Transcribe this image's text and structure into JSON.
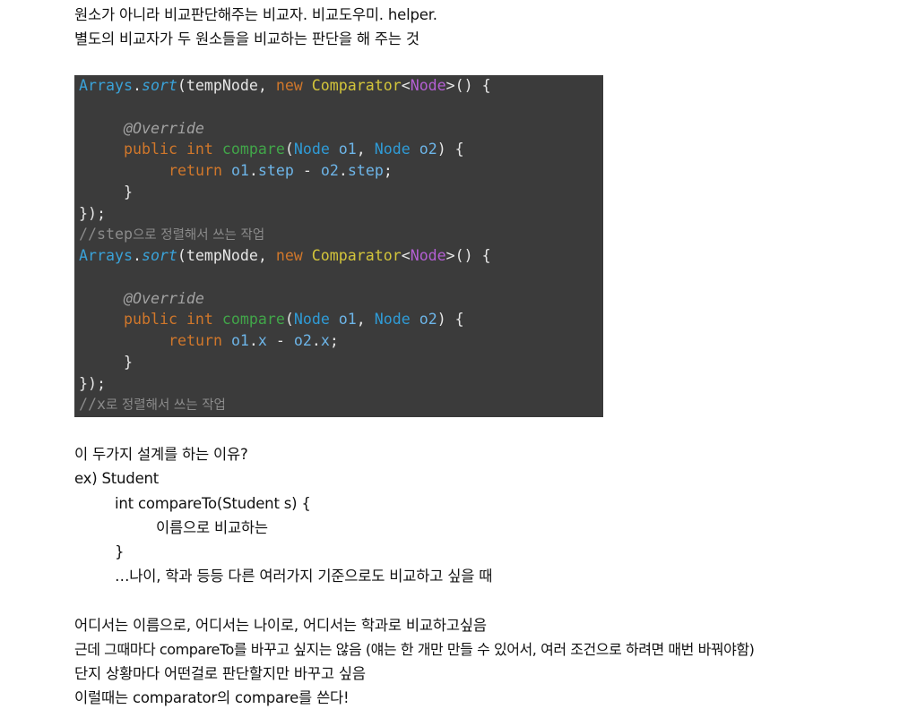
{
  "intro": {
    "line1": "원소가 아니라 비교판단해주는 비교자. 비교도우미. helper.",
    "line2": "별도의 비교자가 두 원소들을 비교하는 판단을 해 주는 것"
  },
  "code": {
    "block1": {
      "l1": {
        "cls": "Arrays",
        "dot": ".",
        "method": "sort",
        "open": "(tempNode, ",
        "kw_new": "new ",
        "comparator": "Comparator",
        "lt": "<",
        "generic": "Node",
        "gt_paren": ">() {"
      },
      "l2": {
        "annotation": "@Override"
      },
      "l3": {
        "kw_public": "public ",
        "kw_int": "int ",
        "method": "compare",
        "paren_open": "(",
        "type1": "Node ",
        "param1": "o1",
        "comma": ", ",
        "type2": "Node ",
        "param2": "o2",
        "paren_close": ") {"
      },
      "l4": {
        "kw_return": "return ",
        "a": "o1",
        "dot1": ".",
        "field_a": "step",
        "minus": " - ",
        "b": "o2",
        "dot2": ".",
        "field_b": "step",
        "semi": ";"
      },
      "l5": "}",
      "l6": "});",
      "comment_prefix": "//step",
      "comment_ko": "으로 정렬해서 쓰는 작업"
    },
    "block2": {
      "l1": {
        "cls": "Arrays",
        "dot": ".",
        "method": "sort",
        "open": "(tempNode, ",
        "kw_new": "new ",
        "comparator": "Comparator",
        "lt": "<",
        "generic": "Node",
        "gt_paren": ">() {"
      },
      "l2": {
        "annotation": "@Override"
      },
      "l3": {
        "kw_public": "public ",
        "kw_int": "int ",
        "method": "compare",
        "paren_open": "(",
        "type1": "Node ",
        "param1": "o1",
        "comma": ", ",
        "type2": "Node ",
        "param2": "o2",
        "paren_close": ") {"
      },
      "l4": {
        "kw_return": "return ",
        "a": "o1",
        "dot1": ".",
        "field_a": "x",
        "minus": " - ",
        "b": "o2",
        "dot2": ".",
        "field_b": "x",
        "semi": ";"
      },
      "l5": "}",
      "l6": "});",
      "comment_prefix": "//x",
      "comment_ko": "로 정렬해서 쓰는 작업"
    }
  },
  "explanation": {
    "q": "이 두가지 설계를 하는 이유?",
    "ex": "ex) Student",
    "ex_sig": "int compareTo(Student s) {",
    "ex_body": "이름으로 비교하는",
    "ex_close": "}",
    "ex_more": "…나이, 학과 등등 다른 여러가지 기준으로도 비교하고 싶을 때",
    "p1": "어디서는 이름으로, 어디서는 나이로, 어디서는 학과로 비교하고싶음",
    "p2": "근데 그때마다 compareTo를 바꾸고 싶지는 않음 (얘는 한 개만 만들 수 있어서, 여러 조건으로 하려면 매번 바꿔야함)",
    "p3": "단지 상황마다 어떤걸로 판단할지만 바꾸고 싶음",
    "p4": "이럴때는 comparator의 compare를 쓴다!"
  }
}
